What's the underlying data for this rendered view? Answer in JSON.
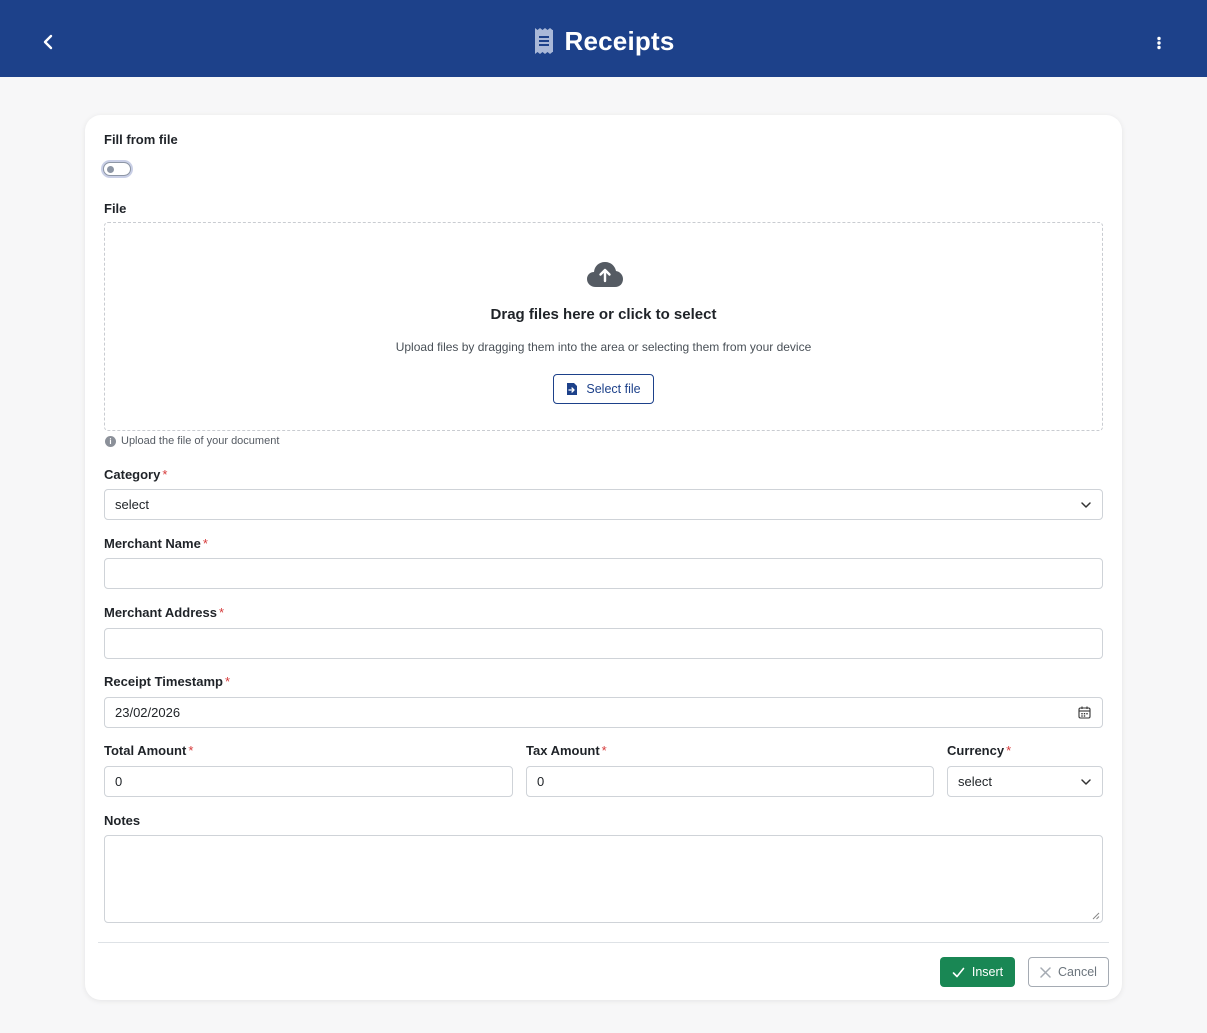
{
  "header": {
    "title": "Receipts",
    "back_icon": "chevron-left-icon",
    "menu_icon": "kebab-vertical-icon",
    "title_icon": "receipt-icon",
    "background_color": "#1d418a"
  },
  "form": {
    "fill_from_file": {
      "label": "Fill from file",
      "checked": false
    },
    "file": {
      "label": "File",
      "dropzone_title": "Drag files here or click to select",
      "dropzone_subtitle": "Upload files by dragging them into the area or selecting them from your device",
      "select_button": "Select file",
      "help_text": "Upload the file of your document",
      "upload_icon": "cloud-upload-icon"
    },
    "category": {
      "label": "Category",
      "required_mark": "*",
      "value": "select"
    },
    "merchant_name": {
      "label": "Merchant Name",
      "required_mark": "*",
      "value": ""
    },
    "merchant_address": {
      "label": "Merchant Address",
      "required_mark": "*",
      "value": ""
    },
    "receipt_timestamp": {
      "label": "Receipt Timestamp",
      "required_mark": "*",
      "value": "23/02/2026"
    },
    "total_amount": {
      "label": "Total Amount",
      "required_mark": "*",
      "value": "0"
    },
    "tax_amount": {
      "label": "Tax Amount",
      "required_mark": "*",
      "value": "0"
    },
    "currency": {
      "label": "Currency",
      "required_mark": "*",
      "value": "select"
    },
    "notes": {
      "label": "Notes",
      "value": ""
    }
  },
  "actions": {
    "insert_label": "Insert",
    "cancel_label": "Cancel",
    "insert_color": "#198754"
  }
}
